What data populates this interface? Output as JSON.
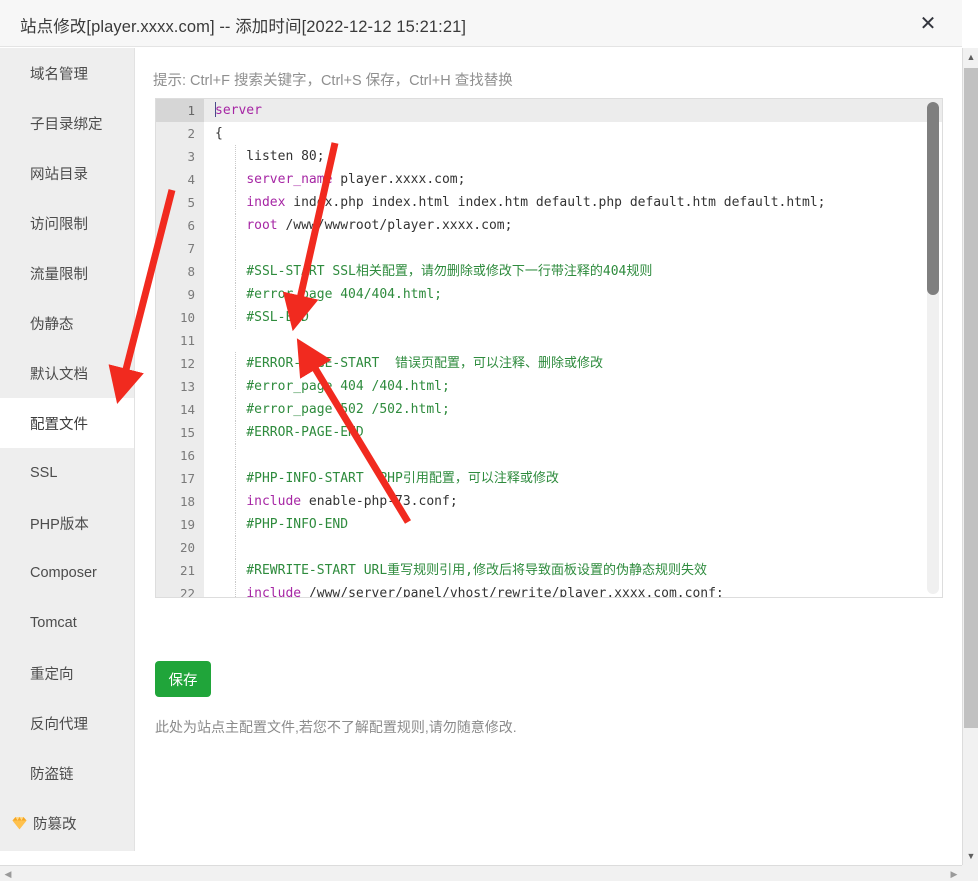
{
  "window": {
    "title": "站点修改[player.xxxx.com] -- 添加时间[2022-12-12 15:21:21]",
    "close_label": "✕"
  },
  "sidebar": {
    "items": [
      {
        "label": "域名管理",
        "active": false,
        "icon": ""
      },
      {
        "label": "子目录绑定",
        "active": false,
        "icon": ""
      },
      {
        "label": "网站目录",
        "active": false,
        "icon": ""
      },
      {
        "label": "访问限制",
        "active": false,
        "icon": ""
      },
      {
        "label": "流量限制",
        "active": false,
        "icon": ""
      },
      {
        "label": "伪静态",
        "active": false,
        "icon": ""
      },
      {
        "label": "默认文档",
        "active": false,
        "icon": ""
      },
      {
        "label": "配置文件",
        "active": true,
        "icon": ""
      },
      {
        "label": "SSL",
        "active": false,
        "icon": ""
      },
      {
        "label": "PHP版本",
        "active": false,
        "icon": ""
      },
      {
        "label": "Composer",
        "active": false,
        "icon": ""
      },
      {
        "label": "Tomcat",
        "active": false,
        "icon": ""
      },
      {
        "label": "重定向",
        "active": false,
        "icon": ""
      },
      {
        "label": "反向代理",
        "active": false,
        "icon": ""
      },
      {
        "label": "防盗链",
        "active": false,
        "icon": ""
      },
      {
        "label": "防篡改",
        "active": false,
        "icon": "diamond-icon"
      }
    ]
  },
  "main": {
    "hint": "提示: Ctrl+F 搜索关键字，Ctrl+S 保存，Ctrl+H 查找替换",
    "save_label": "保存",
    "note": "此处为站点主配置文件,若您不了解配置规则,请勿随意修改.",
    "active_line": 1,
    "colors": {
      "keyword": "#a626a4",
      "comment": "#2e8b3d",
      "accent_green": "#20a53a",
      "arrow_red": "#f12a1f",
      "diamond_gold": "#f5a623"
    },
    "code_lines": [
      {
        "n": "1",
        "indent": false,
        "tokens": [
          {
            "t": "server",
            "c": "kw"
          }
        ]
      },
      {
        "n": "2",
        "indent": false,
        "tokens": [
          {
            "t": "{",
            "c": ""
          }
        ]
      },
      {
        "n": "3",
        "indent": true,
        "tokens": [
          {
            "t": "    listen 80;",
            "c": ""
          }
        ]
      },
      {
        "n": "4",
        "indent": true,
        "tokens": [
          {
            "t": "    ",
            "c": ""
          },
          {
            "t": "server_name",
            "c": "kw"
          },
          {
            "t": " player.xxxx.com;",
            "c": ""
          }
        ]
      },
      {
        "n": "5",
        "indent": true,
        "tokens": [
          {
            "t": "    ",
            "c": ""
          },
          {
            "t": "index",
            "c": "kw"
          },
          {
            "t": " index.php index.html index.htm default.php default.htm default.html;",
            "c": ""
          }
        ]
      },
      {
        "n": "6",
        "indent": true,
        "tokens": [
          {
            "t": "    ",
            "c": ""
          },
          {
            "t": "root",
            "c": "kw"
          },
          {
            "t": " /www/wwwroot/player.xxxx.com;",
            "c": ""
          }
        ]
      },
      {
        "n": "7",
        "indent": true,
        "tokens": [
          {
            "t": "",
            "c": ""
          }
        ]
      },
      {
        "n": "8",
        "indent": true,
        "tokens": [
          {
            "t": "    #SSL-START SSL相关配置，请勿删除或修改下一行带注释的404规则",
            "c": "cm"
          }
        ]
      },
      {
        "n": "9",
        "indent": true,
        "tokens": [
          {
            "t": "    #error_page 404/404.html;",
            "c": "cm"
          }
        ]
      },
      {
        "n": "10",
        "indent": true,
        "tokens": [
          {
            "t": "    #SSL-END",
            "c": "cm"
          }
        ]
      },
      {
        "n": "11",
        "indent": false,
        "tokens": [
          {
            "t": "",
            "c": ""
          }
        ]
      },
      {
        "n": "12",
        "indent": true,
        "tokens": [
          {
            "t": "    #ERROR-PAGE-START  错误页配置，可以注释、删除或修改",
            "c": "cm"
          }
        ]
      },
      {
        "n": "13",
        "indent": true,
        "tokens": [
          {
            "t": "    #error_page 404 /404.html;",
            "c": "cm"
          }
        ]
      },
      {
        "n": "14",
        "indent": true,
        "tokens": [
          {
            "t": "    #error_page 502 /502.html;",
            "c": "cm"
          }
        ]
      },
      {
        "n": "15",
        "indent": true,
        "tokens": [
          {
            "t": "    #ERROR-PAGE-END",
            "c": "cm"
          }
        ]
      },
      {
        "n": "16",
        "indent": true,
        "tokens": [
          {
            "t": "",
            "c": ""
          }
        ]
      },
      {
        "n": "17",
        "indent": true,
        "tokens": [
          {
            "t": "    #PHP-INFO-START  PHP引用配置，可以注释或修改",
            "c": "cm"
          }
        ]
      },
      {
        "n": "18",
        "indent": true,
        "tokens": [
          {
            "t": "    ",
            "c": ""
          },
          {
            "t": "include",
            "c": "kw"
          },
          {
            "t": " enable-php-73.conf;",
            "c": ""
          }
        ]
      },
      {
        "n": "19",
        "indent": true,
        "tokens": [
          {
            "t": "    #PHP-INFO-END",
            "c": "cm"
          }
        ]
      },
      {
        "n": "20",
        "indent": true,
        "tokens": [
          {
            "t": "",
            "c": ""
          }
        ]
      },
      {
        "n": "21",
        "indent": true,
        "tokens": [
          {
            "t": "    #REWRITE-START URL重写规则引用,修改后将导致面板设置的伪静态规则失效",
            "c": "cm"
          }
        ]
      },
      {
        "n": "22",
        "indent": true,
        "tokens": [
          {
            "t": "    ",
            "c": ""
          },
          {
            "t": "include",
            "c": "kw"
          },
          {
            "t": " /www/server/panel/vhost/rewrite/player.xxxx.com.conf;",
            "c": ""
          }
        ]
      }
    ]
  },
  "scrollbars": {
    "up_arrow": "▲",
    "down_arrow": "▼",
    "left_arrow": "◀",
    "right_arrow": "▶"
  }
}
